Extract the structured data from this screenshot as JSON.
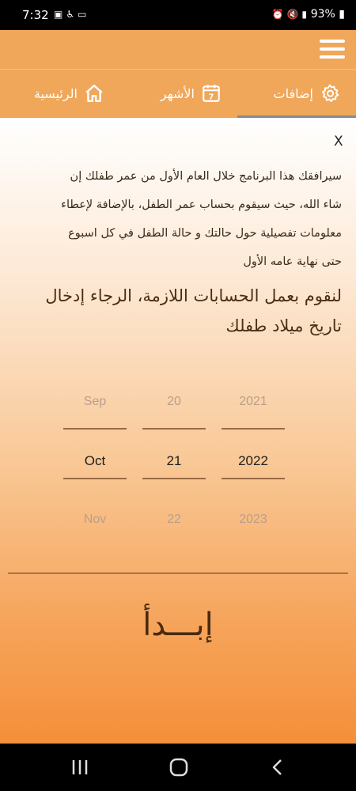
{
  "status": {
    "time": "7:32",
    "battery": "93%",
    "left_icons": [
      "image-icon",
      "accessibility-icon",
      "cast-icon"
    ],
    "right_icons": [
      "alarm-icon",
      "mute-icon",
      "signal-icon"
    ]
  },
  "tabs": [
    {
      "label": "الرئيسية",
      "icon": "home-icon"
    },
    {
      "label": "الأشهر",
      "icon": "calendar-icon",
      "badge": "7"
    },
    {
      "label": "إضافات",
      "icon": "gear-icon"
    }
  ],
  "dialog": {
    "close_label": "X",
    "intro_lines": [
      "سيرافقك هذا البرنامج خلال العام الأول من عمر طفلك إن",
      "شاء الله، حيث سيقوم بحساب عمر الطفل، بالإضافة لإعطاء",
      "معلومات تفصيلية حول حالتك و حالة الطفل في كل اسبوع",
      "حتى نهاية عامه الأول"
    ],
    "prompt_lines": [
      "لنقوم بعمل الحسابات اللازمة، الرجاء إدخال",
      "تاريخ ميلاد طفلك"
    ]
  },
  "date_picker": {
    "month": {
      "prev": "Sep",
      "selected": "Oct",
      "next": "Nov"
    },
    "day": {
      "prev": "20",
      "selected": "21",
      "next": "22"
    },
    "year": {
      "prev": "2021",
      "selected": "2022",
      "next": "2023"
    }
  },
  "start_button": "إبـــدأ"
}
